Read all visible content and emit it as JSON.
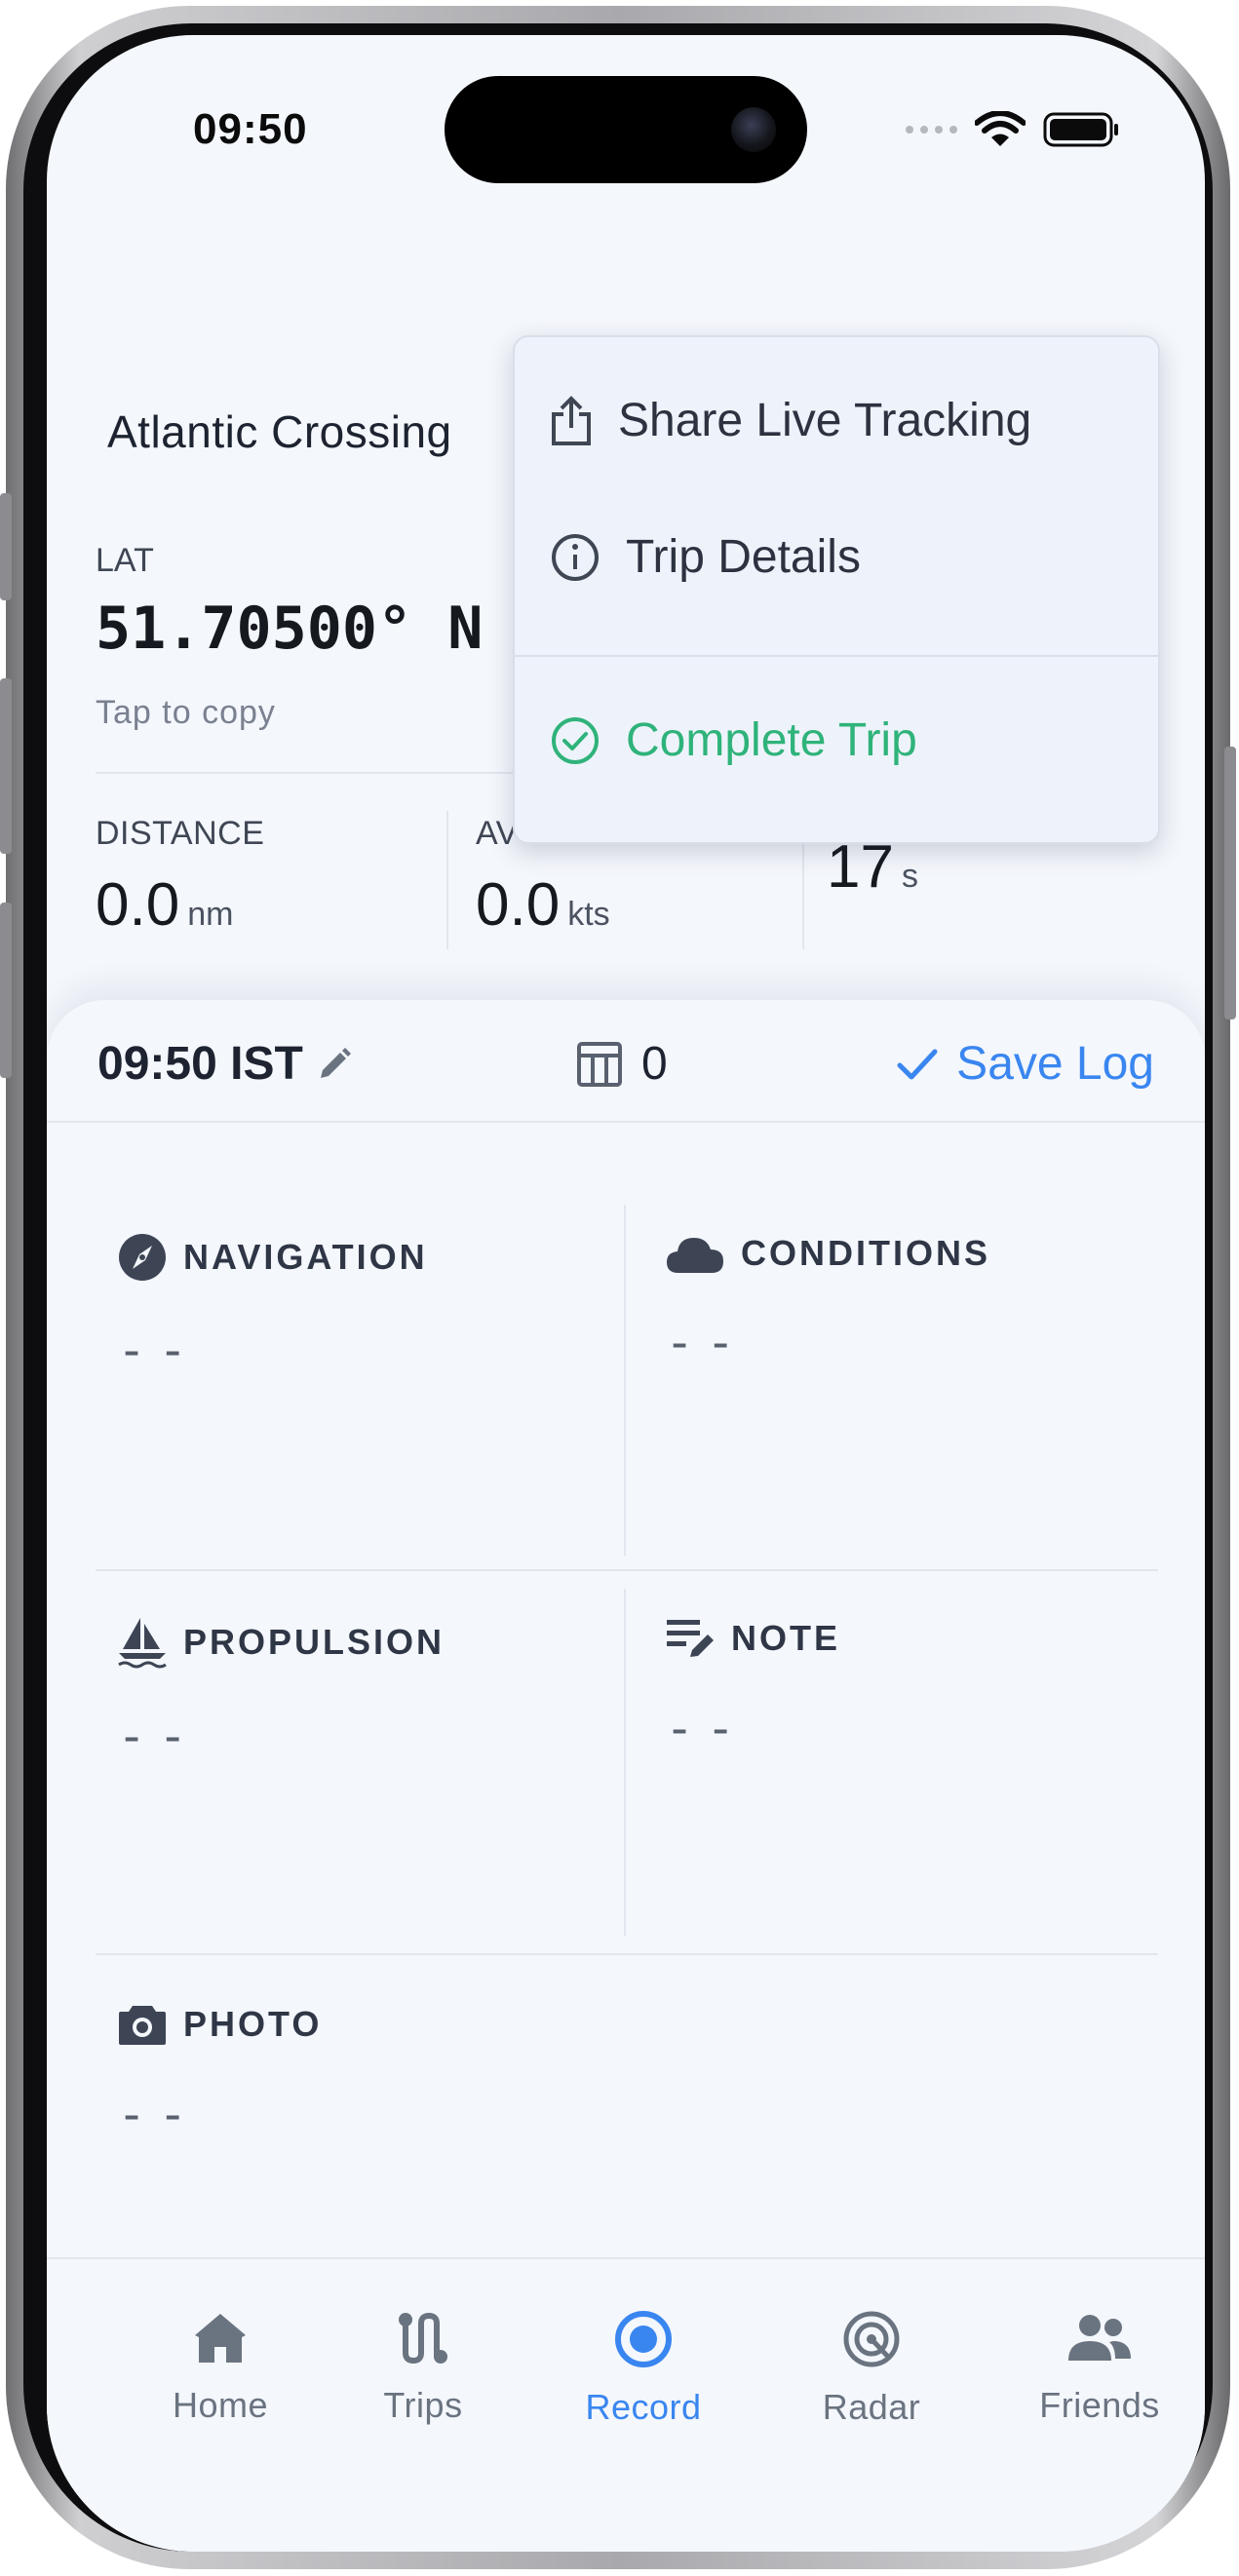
{
  "status_bar": {
    "time": "09:50"
  },
  "trip": {
    "title": "Atlantic Crossing"
  },
  "position": {
    "lat_label": "LAT",
    "lat_value": "51.70500° N",
    "hint": "Tap to copy"
  },
  "stats": [
    {
      "label": "DISTANCE",
      "value": "0.0",
      "unit": "nm"
    },
    {
      "label": "AV",
      "value": "0.0",
      "unit": "kts"
    },
    {
      "label": "",
      "value": "17",
      "unit": "s"
    }
  ],
  "log_entry": {
    "time": "09:50 IST",
    "entry_count": "0",
    "save_label": "Save Log"
  },
  "cards": {
    "navigation": {
      "label": "NAVIGATION",
      "value": "--"
    },
    "conditions": {
      "label": "CONDITIONS",
      "value": "--"
    },
    "propulsion": {
      "label": "PROPULSION",
      "value": "--"
    },
    "note": {
      "label": "NOTE",
      "value": "--"
    },
    "photo": {
      "label": "PHOTO",
      "value": "--"
    }
  },
  "menu": {
    "share_live_tracking": "Share Live Tracking",
    "trip_details": "Trip Details",
    "complete_trip": "Complete Trip"
  },
  "tabs": [
    {
      "label": "Home",
      "icon": "home-icon"
    },
    {
      "label": "Trips",
      "icon": "route-icon"
    },
    {
      "label": "Record",
      "icon": "record-icon"
    },
    {
      "label": "Radar",
      "icon": "radar-icon"
    },
    {
      "label": "Friends",
      "icon": "friends-icon"
    }
  ],
  "colors": {
    "accent": "#3a86f0",
    "success": "#2fb37a",
    "text": "#1d2330",
    "background": "#f4f7fc"
  }
}
